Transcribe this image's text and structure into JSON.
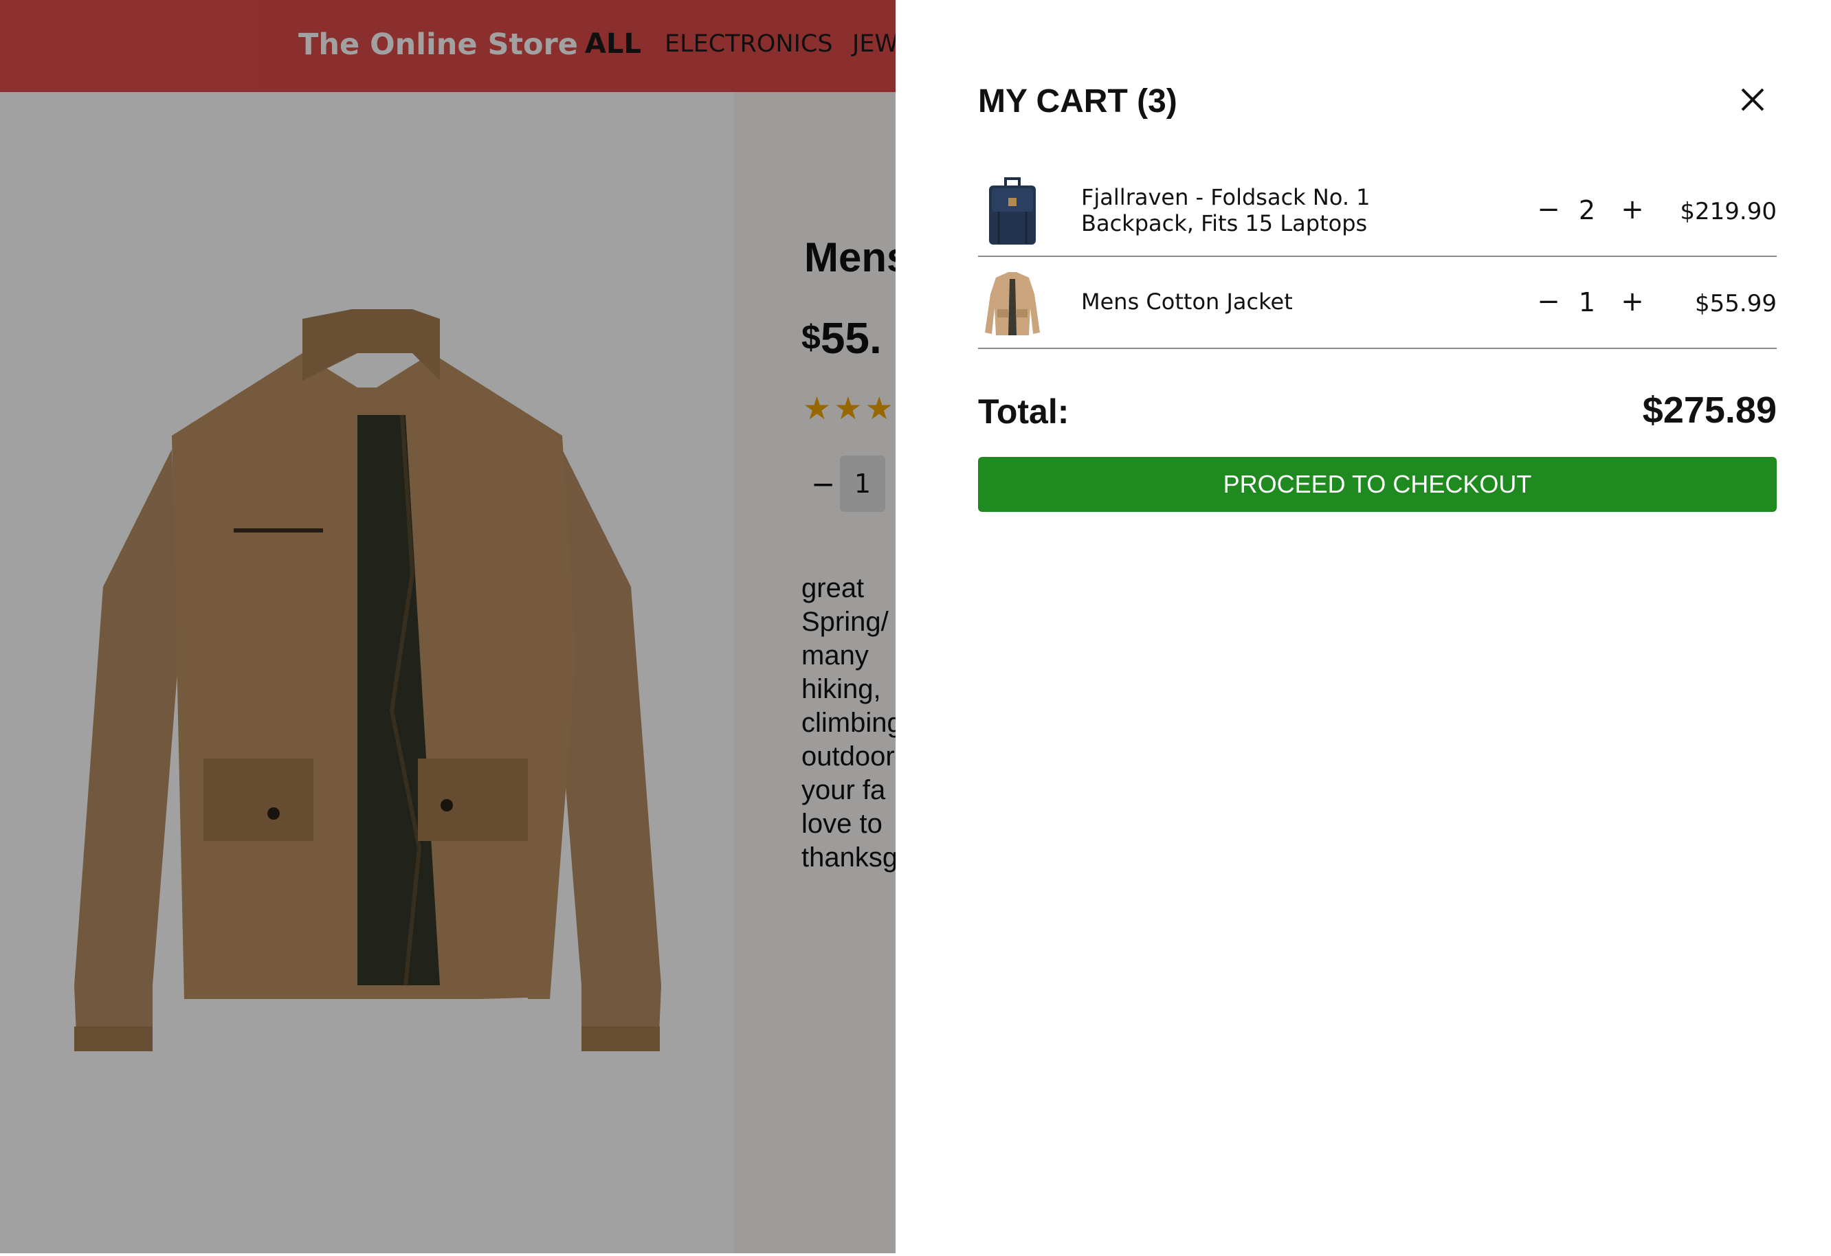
{
  "header": {
    "brand": "The Online Store",
    "nav": [
      "ALL",
      "ELECTRONICS",
      "JEW"
    ]
  },
  "product": {
    "title": "Mens",
    "price_currency": "$",
    "price_value": "55.",
    "rating_stars_visible": 3,
    "quantity": "1",
    "quantity_minus": "−",
    "description_lines": [
      "great",
      "Spring/",
      "many",
      "hiking,",
      "climbing",
      "outdoor",
      "your fa",
      "love to",
      "thanksg"
    ]
  },
  "cart": {
    "title": "MY CART (3)",
    "items": [
      {
        "name": "Fjallraven - Foldsack No. 1 Backpack, Fits 15 Laptops",
        "qty": "2",
        "price": "$219.90",
        "thumb": "backpack-thumbnail"
      },
      {
        "name": "Mens Cotton Jacket",
        "qty": "1",
        "price": "$55.99",
        "thumb": "jacket-thumbnail"
      }
    ],
    "minus": "−",
    "plus": "+",
    "total_label": "Total:",
    "total_value": "$275.89",
    "checkout_label": "PROCEED TO CHECKOUT"
  },
  "colors": {
    "header_bg": "#dc4a4a",
    "checkout_bg": "#1f8a1f",
    "star": "#f0a500",
    "overlay": "rgba(0,0,0,0.37)"
  }
}
